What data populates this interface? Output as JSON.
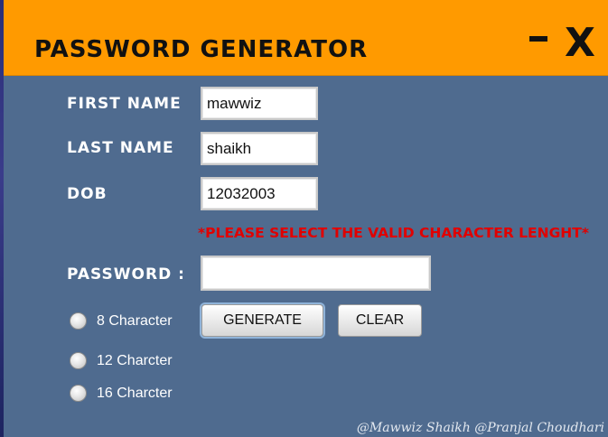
{
  "window": {
    "title": "PASSWORD GENERATOR",
    "minimize_label": "",
    "close_label": "X"
  },
  "form": {
    "first_name_label": "FIRST NAME",
    "first_name_value": "mawwiz",
    "last_name_label": "LAST NAME",
    "last_name_value": "shaikh",
    "dob_label": "DOB",
    "dob_value": "12032003",
    "warning": "*PLEASE SELECT THE VALID CHARACTER LENGHT*",
    "password_label": "PASSWORD :",
    "password_value": ""
  },
  "options": [
    {
      "label": "8 Character",
      "selected": false
    },
    {
      "label": "12 Charcter",
      "selected": false
    },
    {
      "label": "16 Charcter",
      "selected": false
    }
  ],
  "buttons": {
    "generate": "GENERATE",
    "clear": "CLEAR"
  },
  "footer": {
    "credits": "@Mawwiz Shaikh  @Pranjal Choudhari"
  },
  "colors": {
    "titlebar": "#ff9a00",
    "background": "#4f6b8f",
    "warning": "#e00000"
  }
}
